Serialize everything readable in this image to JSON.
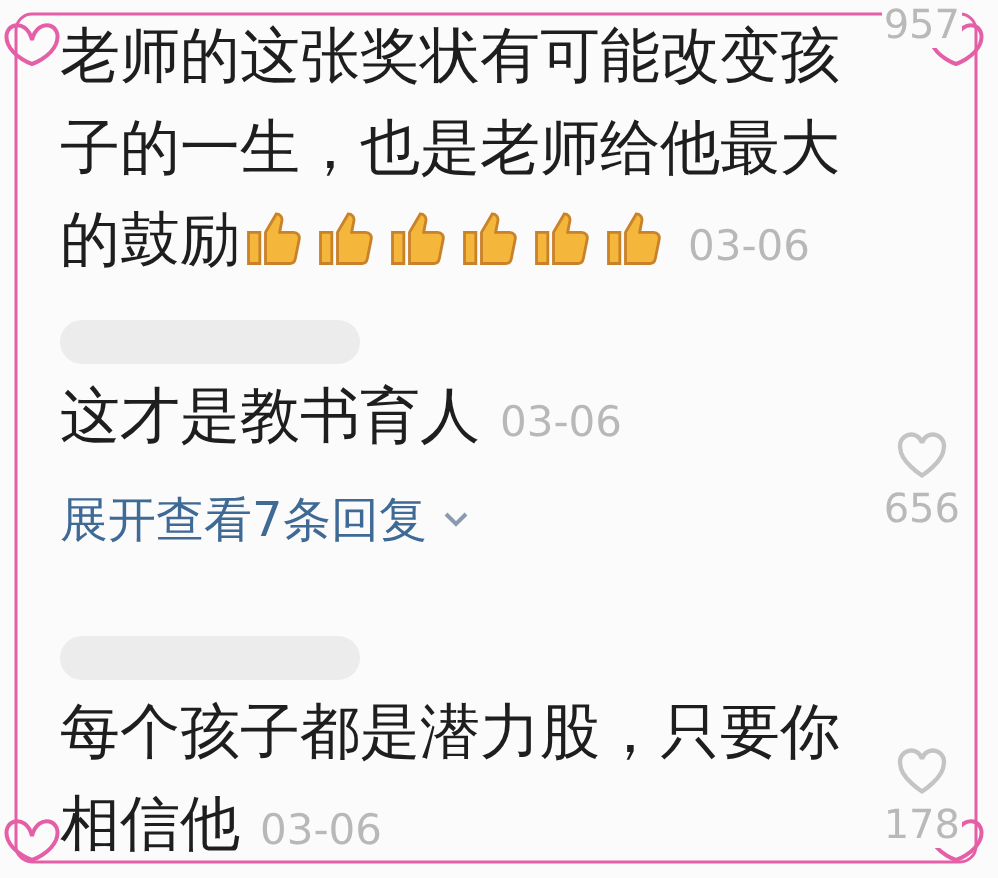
{
  "comments": [
    {
      "kind": "plain",
      "has_username": false,
      "text": "老师的这张奖状有可能改变孩子的一生，也是老师给他最大的鼓励",
      "emojis": [
        {
          "kind": "thumbs-up"
        },
        {
          "kind": "thumbs-up"
        },
        {
          "kind": "thumbs-up"
        },
        {
          "kind": "thumbs-up"
        },
        {
          "kind": "thumbs-up"
        },
        {
          "kind": "thumbs-up"
        }
      ],
      "date": "03-06",
      "likes": "957",
      "liked": false
    },
    {
      "kind": "plain",
      "has_username": true,
      "text": "这才是教书育人",
      "date": "03-06",
      "likes": "656",
      "liked": false,
      "replies": "展开查看7条回复"
    },
    {
      "kind": "plain",
      "has_username": true,
      "text": "每个孩子都是潜力股，只要你相信他",
      "date": "03-06",
      "likes": "178",
      "liked": false
    }
  ]
}
